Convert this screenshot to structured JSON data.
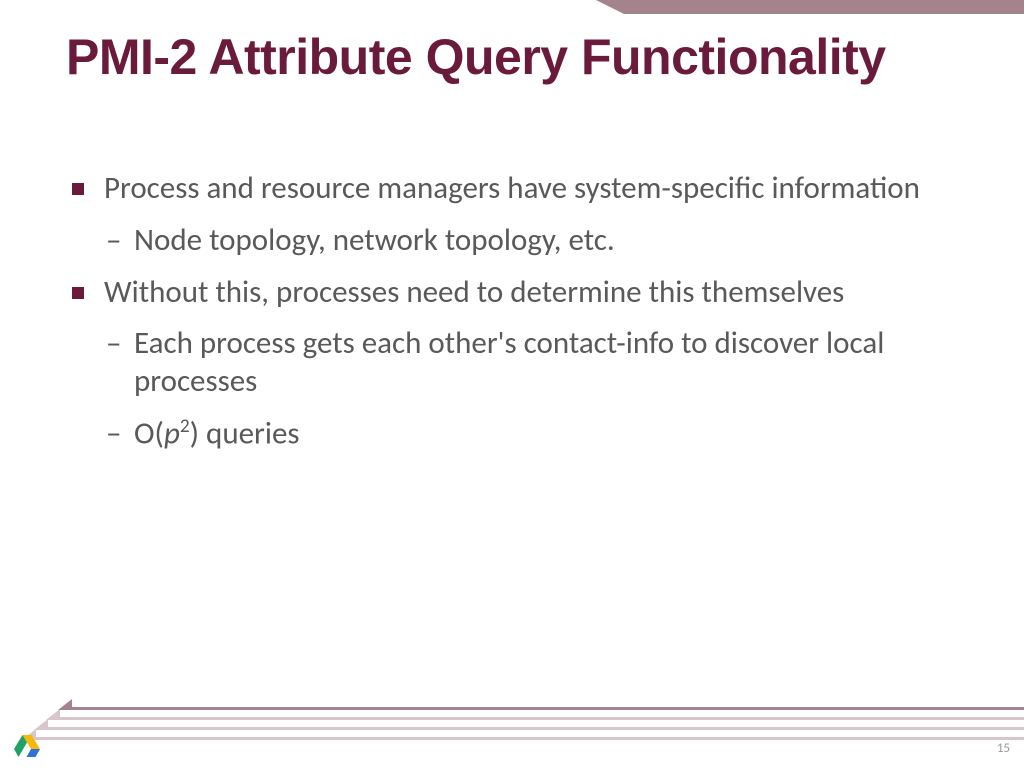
{
  "title": "PMI-2 Attribute Query Functionality",
  "bullets": {
    "b1": "Process and resource managers have system-specific information",
    "b1a": "Node topology, network topology, etc.",
    "b2": "Without this, processes need to determine this themselves",
    "b2a": "Each process gets each other's contact-info to discover local processes",
    "b2b_pre": "O(",
    "b2b_p": "p",
    "b2b_sup": "2",
    "b2b_post": ") queries"
  },
  "page_number": "15"
}
